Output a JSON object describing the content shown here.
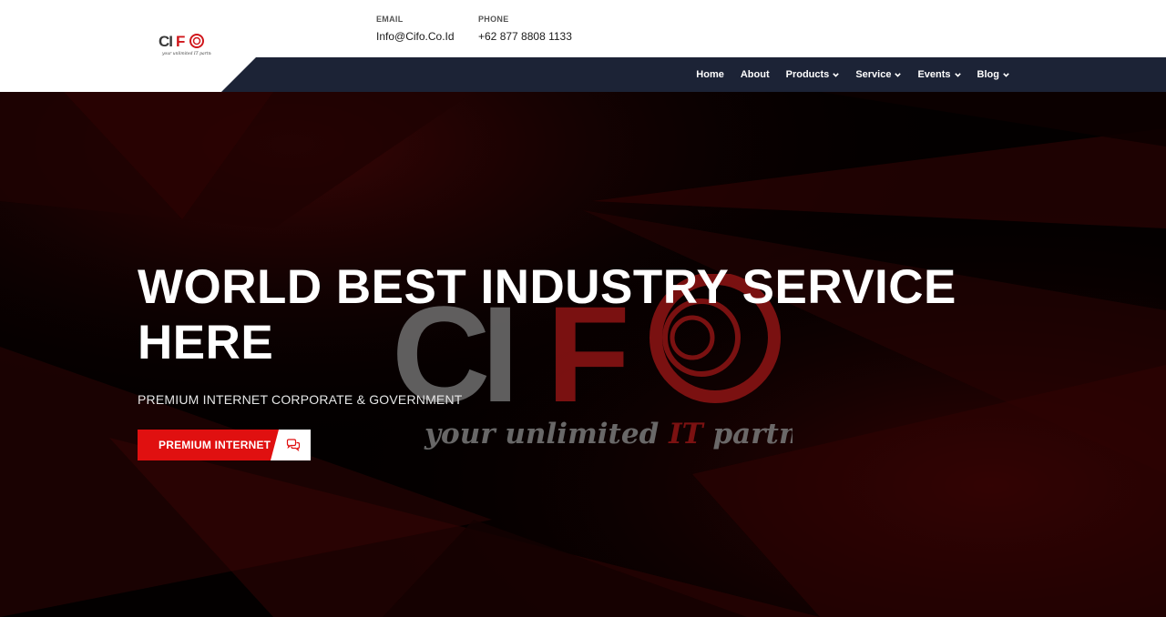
{
  "brand": {
    "logo_text": "CIFO",
    "tagline_prefix": "your unlimited ",
    "tagline_it": "IT",
    "tagline_suffix": " partner",
    "colors": {
      "red": "#e01010",
      "navy": "#1c2336",
      "gray": "#8f8f8f"
    }
  },
  "contact": {
    "email_label": "EMAIL",
    "email_value": "Info@Cifo.Co.Id",
    "phone_label": "PHONE",
    "phone_value": "+62 877 8808 1133"
  },
  "nav": {
    "items": [
      {
        "label": "Home",
        "dropdown": false
      },
      {
        "label": "About",
        "dropdown": false
      },
      {
        "label": "Products",
        "dropdown": true
      },
      {
        "label": "Service",
        "dropdown": true
      },
      {
        "label": "Events",
        "dropdown": true
      },
      {
        "label": "Blog",
        "dropdown": true
      }
    ]
  },
  "hero": {
    "title_line1": "WORLD BEST INDUSTRY SERVICE",
    "title_line2": "HERE",
    "subtitle": "PREMIUM INTERNET CORPORATE & GOVERNMENT",
    "cta_label": "PREMIUM INTERNET",
    "cta_icon": "chat-bubbles-icon"
  }
}
